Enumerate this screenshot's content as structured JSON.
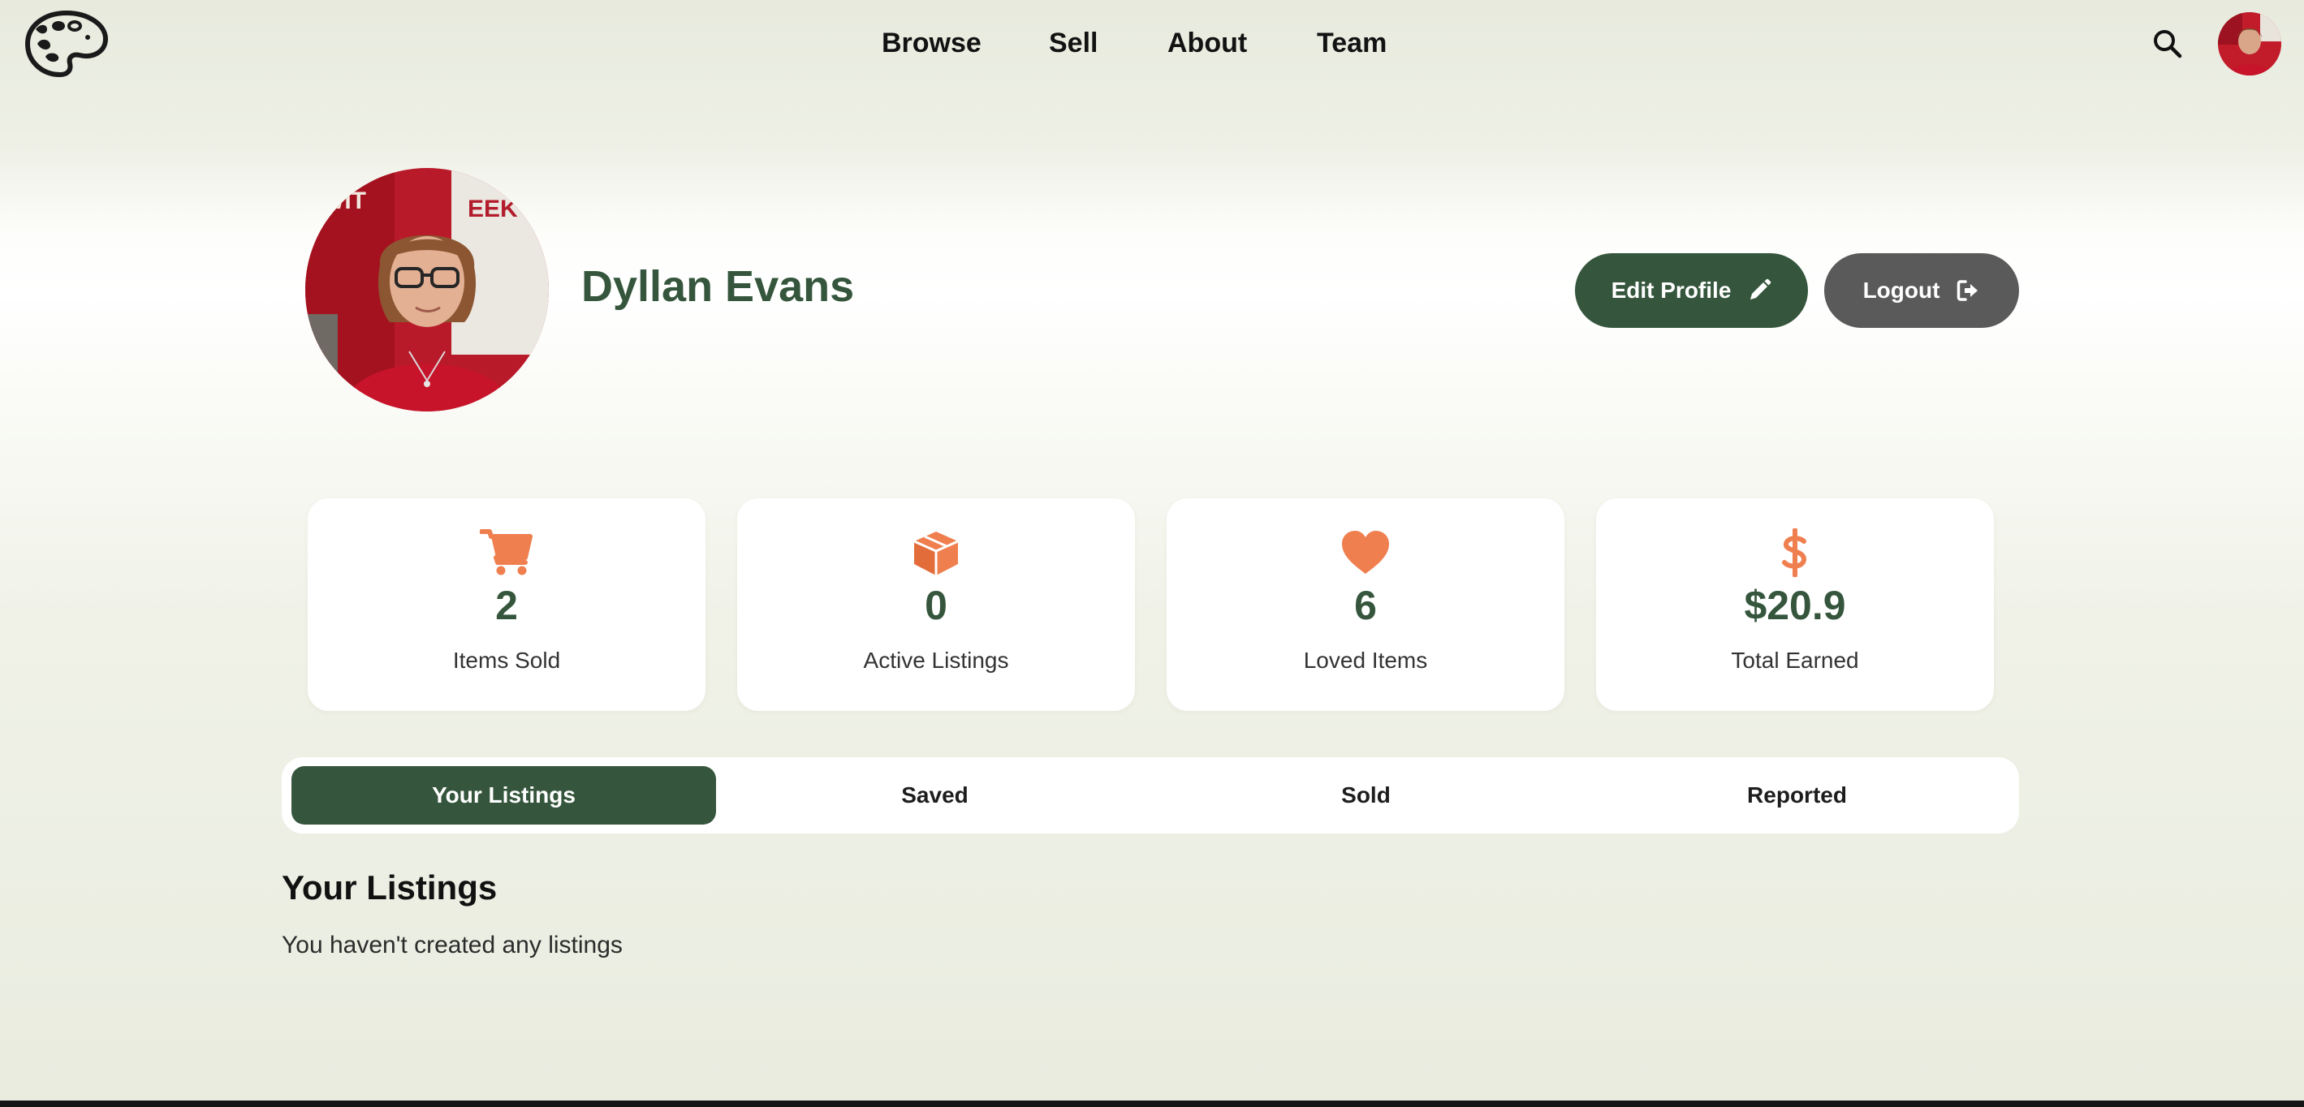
{
  "nav": {
    "links": [
      "Browse",
      "Sell",
      "About",
      "Team"
    ]
  },
  "icons": {
    "logo": "palette-icon",
    "search": "search-icon",
    "edit": "pencil-icon",
    "logout": "sign-out-icon",
    "stats": [
      "cart-icon",
      "box-icon",
      "heart-icon",
      "dollar-icon"
    ]
  },
  "profile": {
    "name": "Dyllan Evans",
    "edit_label": "Edit Profile",
    "logout_label": "Logout"
  },
  "stats": [
    {
      "value": "2",
      "label": "Items Sold"
    },
    {
      "value": "0",
      "label": "Active Listings"
    },
    {
      "value": "6",
      "label": "Loved Items"
    },
    {
      "value": "$20.9",
      "label": "Total Earned"
    }
  ],
  "tabs": [
    "Your Listings",
    "Saved",
    "Sold",
    "Reported"
  ],
  "active_tab": "Your Listings",
  "section": {
    "title": "Your Listings",
    "empty_message": "You haven't created any listings"
  },
  "colors": {
    "brand_green": "#35563d",
    "accent_orange": "#ef7f4f",
    "logout_gray": "#5a5a5a"
  }
}
